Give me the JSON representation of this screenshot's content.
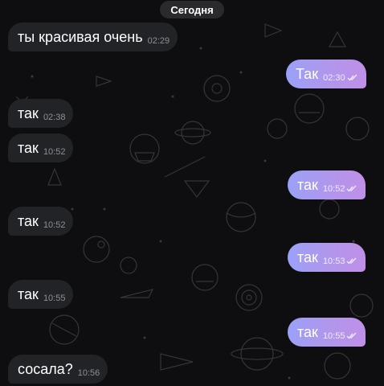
{
  "date_pill": "Сегодня",
  "colors": {
    "background": "#0e0e10",
    "incoming_bubble": "#212326",
    "outgoing_start": "#9aa1f7",
    "outgoing_end": "#c08fe8"
  },
  "messages": [
    {
      "direction": "in",
      "text": "ты красивая очень",
      "time": "02:29"
    },
    {
      "direction": "out",
      "text": "Так",
      "time": "02:30",
      "status": "read"
    },
    {
      "direction": "in",
      "text": "так",
      "time": "02:38"
    },
    {
      "direction": "in",
      "text": "так",
      "time": "10:52"
    },
    {
      "direction": "out",
      "text": "так",
      "time": "10:52",
      "status": "read"
    },
    {
      "direction": "in",
      "text": "так",
      "time": "10:52"
    },
    {
      "direction": "out",
      "text": "так",
      "time": "10:53",
      "status": "read"
    },
    {
      "direction": "in",
      "text": "так",
      "time": "10:55"
    },
    {
      "direction": "out",
      "text": "так",
      "time": "10:55",
      "status": "read"
    },
    {
      "direction": "in",
      "text": "сосала?",
      "time": "10:56"
    }
  ]
}
